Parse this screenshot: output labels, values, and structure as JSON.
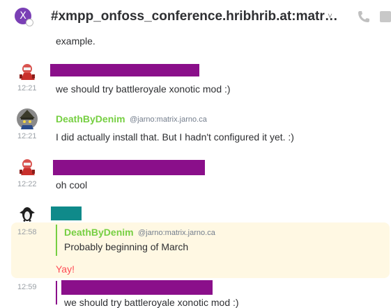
{
  "header": {
    "room_avatar_letter": "X",
    "room_title": "#xmpp_onfoss_conference.hribhrib.at:matr…",
    "chevron": "˅"
  },
  "timeline": {
    "prev_tail": "example.",
    "messages": [
      {
        "time": "12:21",
        "text": "we should try battleroyale xonotic mod :)"
      },
      {
        "time": "12:21",
        "sender": "DeathByDenim",
        "user_id": "@jarno:matrix.jarno.ca",
        "text": "I did actually install that. But I hadn't configured it yet. :)"
      },
      {
        "time": "12:22",
        "text": "oh cool"
      },
      {
        "time": "12:58",
        "sender": "DeathByDenim",
        "user_id": "@jarno:matrix.jarno.ca",
        "quote_text": "Probably beginning of March",
        "text": "Yay!"
      },
      {
        "time": "12:59",
        "text": "we should try battleroyale xonotic mod :)"
      }
    ]
  },
  "colors": {
    "redact_purple": "#8a0f8a",
    "redact_teal": "#0f8a8a",
    "sender_green": "#76cf42",
    "highlight_bg": "#fff8e3",
    "mention_red": "#ff4b55"
  }
}
